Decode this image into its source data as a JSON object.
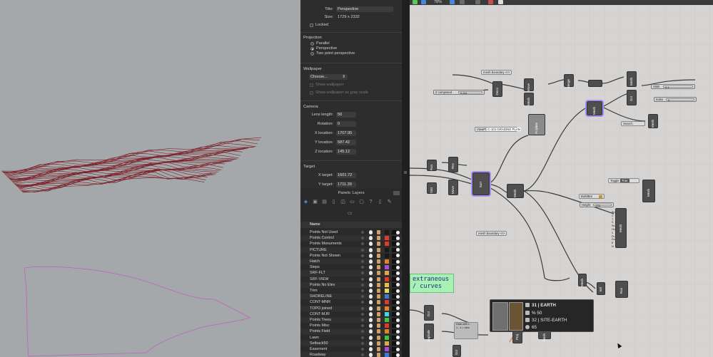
{
  "properties": {
    "title_label": "Title:",
    "title_value": "Perspective",
    "size_label": "Size:",
    "size_value": "1729 x 2332",
    "locked_label": "Locked",
    "projection_heading": "Projection",
    "projection_options": [
      "Parallel",
      "Perspective",
      "Two point perspective"
    ],
    "projection_selected": "Perspective",
    "wallpaper_heading": "Wallpaper",
    "wallpaper_choose": "Choose...",
    "show_wallpaper": "Show wallpaper",
    "show_gray": "Show wallpaper as gray scale",
    "camera_heading": "Camera",
    "camera_fields": [
      {
        "label": "Lens length:",
        "value": "50"
      },
      {
        "label": "Rotation:",
        "value": "0"
      },
      {
        "label": "X location:",
        "value": "1707.95"
      },
      {
        "label": "Y location:",
        "value": "587.42"
      },
      {
        "label": "Z location:",
        "value": "145.12"
      }
    ],
    "target_heading": "Target",
    "target_fields": [
      {
        "label": "X target:",
        "value": "1601.72"
      },
      {
        "label": "Y target:",
        "value": "1711.39"
      }
    ]
  },
  "layers_panel": {
    "title": "Panels: Layers",
    "column_name": "Name",
    "layers": [
      {
        "name": "Points Not Used",
        "color": "#1a1a1a"
      },
      {
        "name": "Points Control",
        "color": "#e23a2a"
      },
      {
        "name": "Points Monuments",
        "color": "#e23a2a"
      },
      {
        "name": "PICTURE",
        "color": "#1a1a1a"
      },
      {
        "name": "Points Not Shown",
        "color": "#1a1a1a"
      },
      {
        "name": "Hatch",
        "color": "#e8802a"
      },
      {
        "name": "Steps",
        "color": "#b04ad8"
      },
      {
        "name": "SRF-FLT",
        "color": "#e8a24a"
      },
      {
        "name": "SRF-VIEW",
        "color": "#e23a2a"
      },
      {
        "name": "Points No Elev",
        "color": "#e8c03a"
      },
      {
        "name": "Trim",
        "color": "#e8d85a"
      },
      {
        "name": "SHORELINE",
        "color": "#3a7ad8"
      },
      {
        "name": "CONT-MNR",
        "color": "#e23a2a"
      },
      {
        "name": "TOPO joined",
        "color": "#e8802a"
      },
      {
        "name": "CONT-MJR",
        "color": "#3ad8e8"
      },
      {
        "name": "Points Trees",
        "color": "#3ac83a"
      },
      {
        "name": "Points Misc",
        "color": "#e23a2a"
      },
      {
        "name": "Points Field",
        "color": "#e8802a"
      },
      {
        "name": "Lawn",
        "color": "#3ac83a"
      },
      {
        "name": "Setback50",
        "color": "#e8a24a"
      },
      {
        "name": "Easement",
        "color": "#b04ad8"
      },
      {
        "name": "Roadway",
        "color": "#3a7ad8"
      }
    ]
  },
  "gh": {
    "zoom": "78%",
    "params": {
      "mesh_boundary_1": "mesh boundary <r>",
      "z_composed": "Z composed",
      "viewpt": "ViewPt",
      "viewpt_val": "C-101 GRADING PLAN",
      "mesh_boundary_2": "mesh boundary <r>",
      "toggle_label": "Toggle",
      "toggle_value": "True",
      "search": "Search",
      "slide": "Slide",
      "index": "Index",
      "height": "Height",
      "buildbar": "BuildBar"
    },
    "sliders": {
      "z_val": "0.111",
      "slide_val": "0.1",
      "index_val": "2",
      "height_val": "178"
    },
    "components": [
      "Deco",
      "Move",
      "Mesh",
      "Merge",
      "Mesh",
      "Polyline",
      "Mesh",
      "Dot",
      "Mesh",
      "Mesh",
      "Run",
      "Rec",
      "Dist",
      "Move",
      "Sort",
      "Mesh",
      "Mesh",
      "Mesh",
      "Mesh",
      "Sel",
      "Run",
      "Dot",
      "Explode",
      "Proj",
      "Dot",
      "Mesh",
      "Move"
    ],
    "mesh_ports": [
      "Bm",
      "C",
      "T",
      "S",
      "Ss",
      "Hs",
      "1",
      "Fs",
      "Ds",
      "E",
      "N"
    ],
    "note": "extraneous\n/ curves",
    "tooltip": {
      "line1": "31 | EARTH",
      "line2": "50",
      "line2_prefix": "%",
      "line3": "32 | SITE-EARTH",
      "line4": "65"
    },
    "small_label": "Data with t...\n1 - 4 = wire"
  }
}
